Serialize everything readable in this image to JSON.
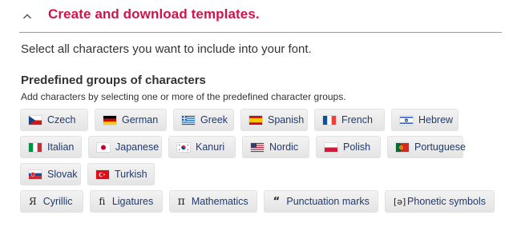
{
  "header": {
    "title": "Create and download templates.",
    "chevron_icon": "chevron-up-icon",
    "accent_color": "#d2134a"
  },
  "intro_text": "Select all characters you want to include into your font.",
  "section": {
    "title": "Predefined groups of characters",
    "subtitle": "Add characters by selecting one or more of the predefined character groups."
  },
  "chips": {
    "row1": [
      {
        "label": "Czech",
        "icon": "czech-flag-icon"
      },
      {
        "label": "German",
        "icon": "german-flag-icon"
      },
      {
        "label": "Greek",
        "icon": "greek-flag-icon"
      },
      {
        "label": "Spanish",
        "icon": "spanish-flag-icon"
      },
      {
        "label": "French",
        "icon": "french-flag-icon"
      },
      {
        "label": "Hebrew",
        "icon": "hebrew-flag-icon"
      }
    ],
    "row2": [
      {
        "label": "Italian",
        "icon": "italian-flag-icon"
      },
      {
        "label": "Japanese",
        "icon": "japanese-flag-icon"
      },
      {
        "label": "Kanuri",
        "icon": "kanuri-flag-icon"
      },
      {
        "label": "Nordic",
        "icon": "nordic-flag-icon"
      },
      {
        "label": "Polish",
        "icon": "polish-flag-icon"
      },
      {
        "label": "Portuguese",
        "icon": "portuguese-flag-icon"
      }
    ],
    "row3": [
      {
        "label": "Slovak",
        "icon": "slovak-flag-icon"
      },
      {
        "label": "Turkish",
        "icon": "turkish-flag-icon"
      }
    ],
    "row4": [
      {
        "label": "Cyrillic",
        "glyph": "Я",
        "icon": "cyrillic-glyph-icon"
      },
      {
        "label": "Ligatures",
        "glyph": "ﬁ",
        "icon": "ligature-glyph-icon"
      },
      {
        "label": "Mathematics",
        "glyph": "π",
        "icon": "pi-glyph-icon"
      },
      {
        "label": "Punctuation marks",
        "glyph": "“",
        "icon": "quote-glyph-icon"
      },
      {
        "label": "Phonetic symbols",
        "glyph": "[ə]",
        "icon": "phonetic-glyph-icon"
      }
    ]
  },
  "colors": {
    "chip_text": "#1f3a73",
    "chip_bg": "#e9e9e9",
    "divider": "#9a9a9a"
  }
}
